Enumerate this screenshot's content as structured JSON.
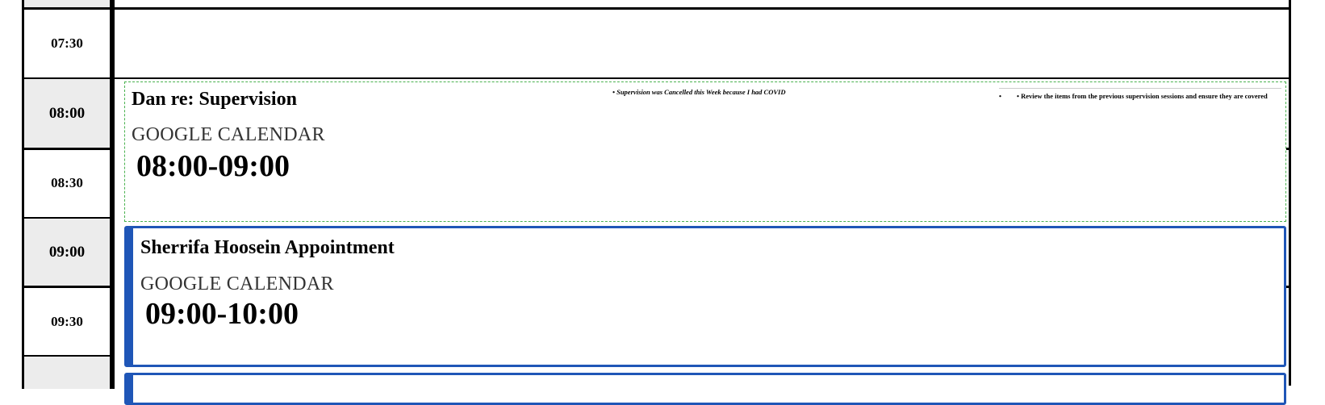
{
  "time_slots": [
    {
      "label": "07:30",
      "kind": "half"
    },
    {
      "label": "08:00",
      "kind": "hour"
    },
    {
      "label": "08:30",
      "kind": "half"
    },
    {
      "label": "09:00",
      "kind": "hour"
    },
    {
      "label": "09:30",
      "kind": "half"
    }
  ],
  "events": [
    {
      "title": "Dan re: Supervision",
      "source": "GOOGLE CALENDAR",
      "time_range": "08:00-09:00",
      "style": "dashed",
      "note_center": "• Supervision was Cancelled this Week because I had COVID",
      "note_right_bullet": "•",
      "note_right": "• Review the items from the previous supervision sessions and ensure they are covered"
    },
    {
      "title": "Sherrifa Hoosein Appointment",
      "source": "GOOGLE CALENDAR",
      "time_range": "09:00-10:00",
      "style": "blue"
    }
  ],
  "colors": {
    "hour_slot_bg": "#ececec",
    "accent_blue": "#1f56b7",
    "dashed_green": "#49b24f"
  }
}
